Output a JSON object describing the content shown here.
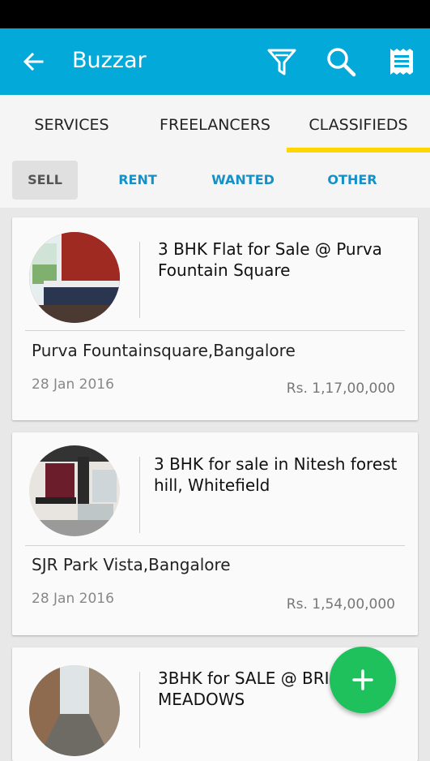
{
  "app": {
    "title": "Buzzar"
  },
  "tabs": [
    {
      "label": "SERVICES"
    },
    {
      "label": "FREELANCERS"
    },
    {
      "label": "CLASSIFIEDS"
    }
  ],
  "subtabs": [
    {
      "label": "SELL"
    },
    {
      "label": "RENT"
    },
    {
      "label": "WANTED"
    },
    {
      "label": "OTHER"
    }
  ],
  "listings": [
    {
      "title": "3 BHK Flat for Sale @ Purva Fountain Square",
      "location": "Purva Fountainsquare,Bangalore",
      "date": "28 Jan 2016",
      "price": "Rs. 1,17,00,000"
    },
    {
      "title": "3 BHK for sale in Nitesh forest hill, Whitefield",
      "location": "SJR Park Vista,Bangalore",
      "date": "28 Jan 2016",
      "price": "Rs. 1,54,00,000"
    },
    {
      "title": "3BHK for SALE @ BRIGADE MEADOWS"
    }
  ],
  "colors": {
    "primary": "#03a9d8",
    "indicator": "#ffd600",
    "fab": "#1ec15c",
    "link": "#1591c8"
  },
  "icons": [
    "back-arrow-icon",
    "filter-icon",
    "search-icon",
    "receipt-icon",
    "plus-icon"
  ]
}
